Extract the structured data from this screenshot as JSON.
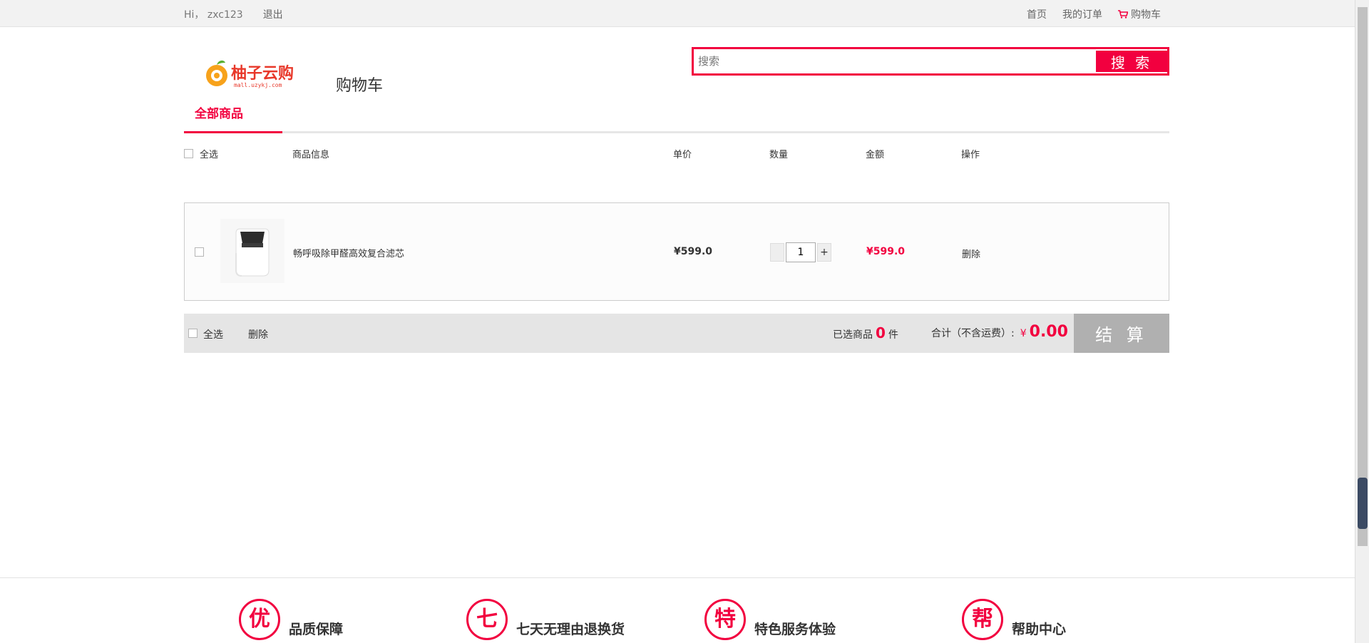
{
  "topbar": {
    "greeting": "Hi， zxc123",
    "logout": "退出",
    "home": "首页",
    "orders": "我的订单",
    "cart": "购物车"
  },
  "header": {
    "logo_text": "柚子云购",
    "logo_sub": "mall.uzykj.com",
    "cart_title": "购物车",
    "search_placeholder": "搜索",
    "search_button": "搜 索"
  },
  "tabs": {
    "all": "全部商品"
  },
  "columns": {
    "select_all": "全选",
    "info": "商品信息",
    "unit_price": "单价",
    "quantity": "数量",
    "amount": "金额",
    "action": "操作"
  },
  "items": [
    {
      "name": "畅呼吸除甲醛高效复合滤芯",
      "price": "¥599.0",
      "quantity": "1",
      "amount": "¥599.0",
      "delete": "删除",
      "decrement": "-",
      "increment": "+"
    }
  ],
  "summary": {
    "select_all": "全选",
    "delete": "删除",
    "selected_prefix": "已选商品",
    "selected_count": "0",
    "selected_suffix": "件",
    "total_label": "合计（不含运费）:",
    "currency": "¥",
    "total": "0.00",
    "checkout": "结 算"
  },
  "services": [
    {
      "icon_char": "优",
      "title": "品质保障"
    },
    {
      "icon_char": "七",
      "title": "七天无理由退换货"
    },
    {
      "icon_char": "特",
      "title": "特色服务体验"
    },
    {
      "icon_char": "帮",
      "title": "帮助中心"
    }
  ],
  "colors": {
    "accent": "#f2003f",
    "checkout_disabled": "#b0b0b0"
  }
}
